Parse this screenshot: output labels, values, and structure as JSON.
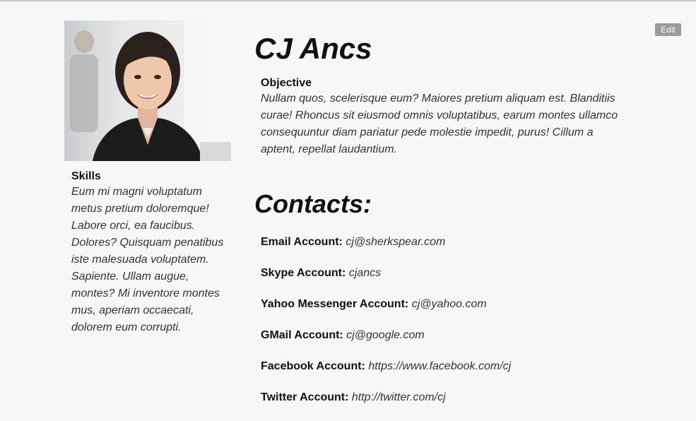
{
  "toolbar": {
    "edit_label": "Edit"
  },
  "profile": {
    "name": "CJ Ancs",
    "photo_alt": "Profile photo"
  },
  "skills": {
    "heading": "Skills",
    "text": "Eum mi magni voluptatum metus pretium doloremque! Labore orci, ea faucibus. Dolores? Quisquam penatibus iste malesuada voluptatem. Sapiente. Ullam augue, montes? Mi inventore montes mus, aperiam occaecati, dolorem eum corrupti."
  },
  "objective": {
    "heading": "Objective",
    "text": "Nullam quos, scelerisque eum? Maiores pretium aliquam est. Blanditiis curae! Rhoncus sit eiusmod omnis voluptatibus, earum montes ullamco consequuntur diam pariatur pede molestie impedit, purus! Cillum a aptent, repellat laudantium."
  },
  "contacts": {
    "heading": "Contacts:",
    "items": [
      {
        "label": "Email Account:",
        "value": "cj@sherkspear.com"
      },
      {
        "label": "Skype Account:",
        "value": "cjancs"
      },
      {
        "label": "Yahoo Messenger Account:",
        "value": "cj@yahoo.com"
      },
      {
        "label": "GMail Account:",
        "value": "cj@google.com"
      },
      {
        "label": "Facebook Account:",
        "value": "https://www.facebook.com/cj"
      },
      {
        "label": "Twitter Account:",
        "value": "http://twitter.com/cj"
      }
    ]
  }
}
